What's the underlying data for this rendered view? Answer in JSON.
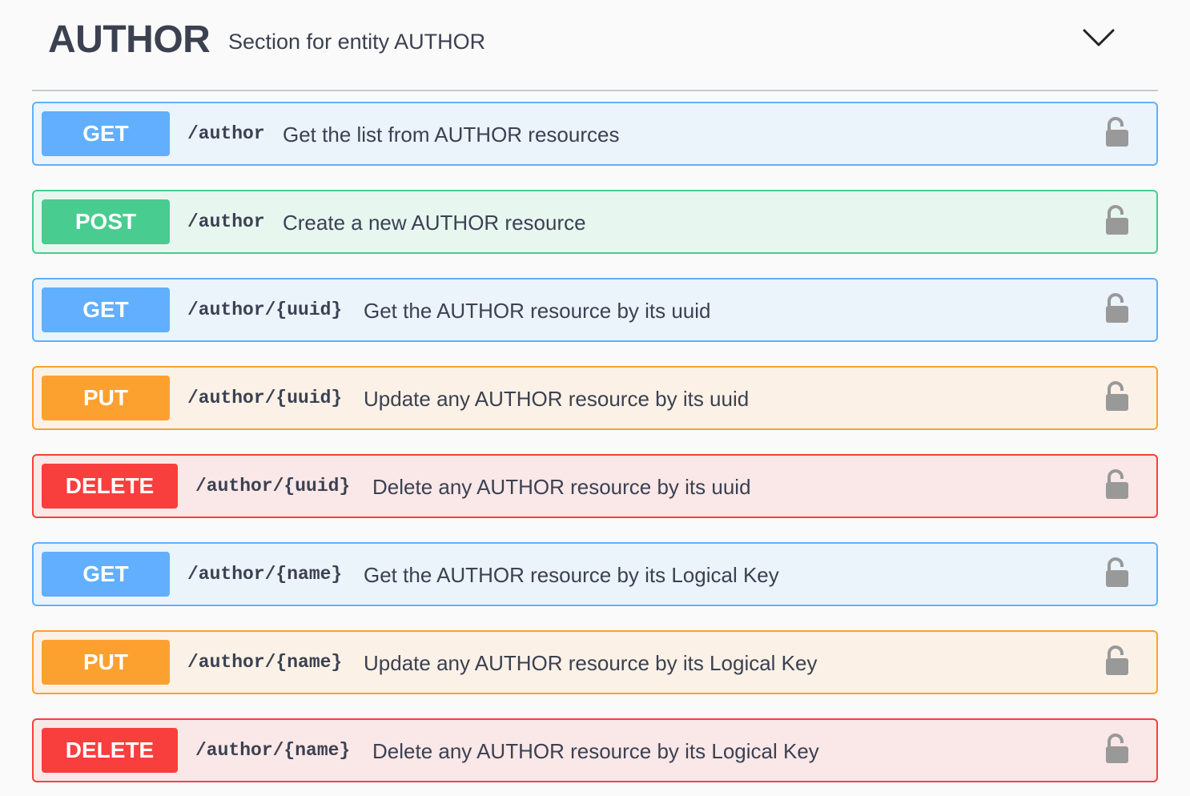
{
  "tag": {
    "name": "AUTHOR",
    "description": "Section for entity AUTHOR"
  },
  "colors": {
    "get": "#61affe",
    "post": "#49cc90",
    "put": "#fca130",
    "delete": "#f93e3e",
    "text": "#3b4151",
    "lock": "#999999"
  },
  "operations": [
    {
      "method": "GET",
      "path": "/author",
      "summary": "Get the list from AUTHOR resources"
    },
    {
      "method": "POST",
      "path": "/author",
      "summary": "Create a new AUTHOR resource"
    },
    {
      "method": "GET",
      "path": "/author/{uuid}",
      "summary": "Get the AUTHOR resource by its uuid"
    },
    {
      "method": "PUT",
      "path": "/author/{uuid}",
      "summary": "Update any AUTHOR resource by its uuid"
    },
    {
      "method": "DELETE",
      "path": "/author/{uuid}",
      "summary": "Delete any AUTHOR resource by its uuid"
    },
    {
      "method": "GET",
      "path": "/author/{name}",
      "summary": "Get the AUTHOR resource by its Logical Key"
    },
    {
      "method": "PUT",
      "path": "/author/{name}",
      "summary": "Update any AUTHOR resource by its Logical Key"
    },
    {
      "method": "DELETE",
      "path": "/author/{name}",
      "summary": "Delete any AUTHOR resource by its Logical Key"
    }
  ],
  "icons": {
    "collapse": "chevron-down-icon",
    "authorization": "unlocked-padlock-icon"
  }
}
